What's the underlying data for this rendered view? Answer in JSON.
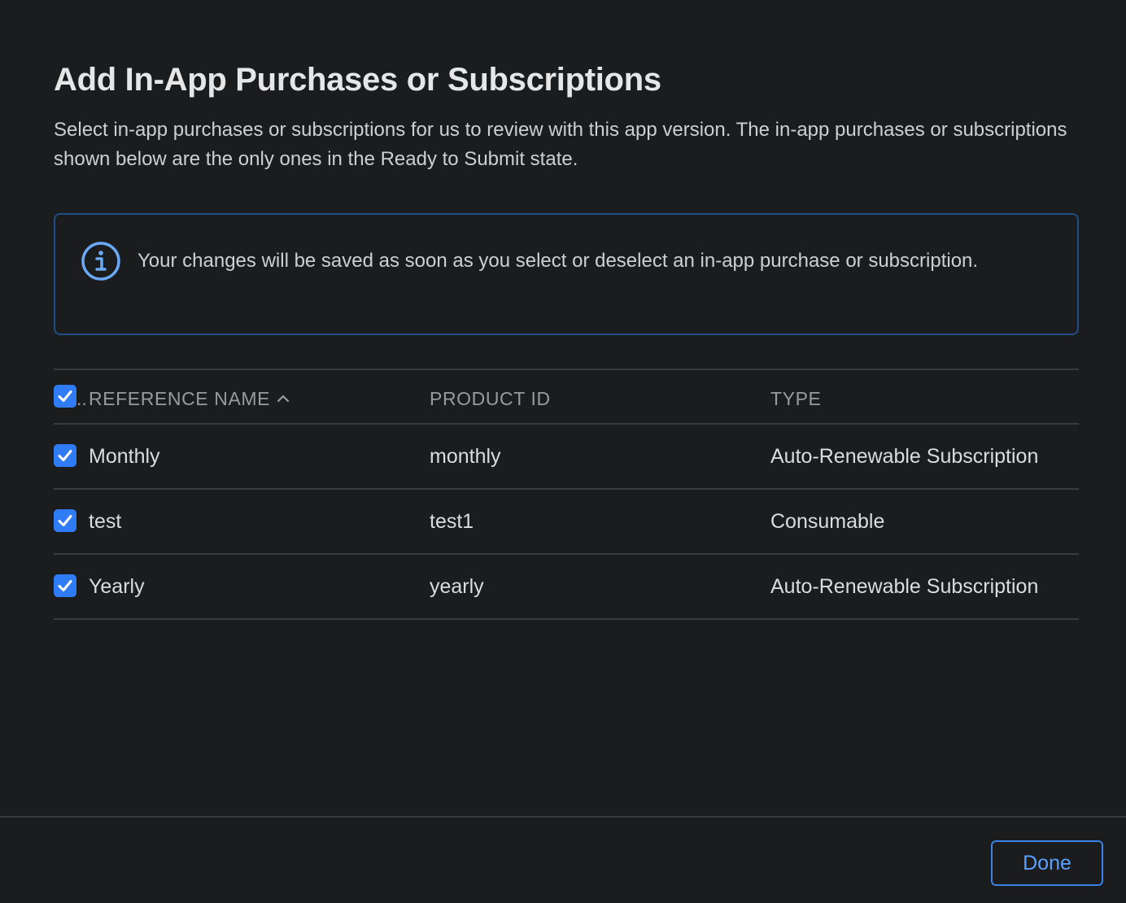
{
  "dialog": {
    "title": "Add In-App Purchases or Subscriptions",
    "description": "Select in-app purchases or subscriptions for us to review with this app version. The in-app purchases or subscriptions shown below are the only ones in the Ready to Submit state."
  },
  "info": {
    "icon": "info-circle-icon",
    "text": "Your changes will be saved as soon as you select or deselect an in-app purchase or subscription."
  },
  "table": {
    "header": {
      "ellipsis": "..",
      "reference_name": "REFERENCE NAME",
      "product_id": "PRODUCT ID",
      "type": "TYPE",
      "sort_icon": "chevron-up-icon",
      "select_all_checked": true
    },
    "rows": [
      {
        "name": "Monthly",
        "product_id": "monthly",
        "type": "Auto-Renewable Subscription",
        "checked": true
      },
      {
        "name": "test",
        "product_id": "test1",
        "type": "Consumable",
        "checked": true
      },
      {
        "name": "Yearly",
        "product_id": "yearly",
        "type": "Auto-Renewable Subscription",
        "checked": true
      }
    ]
  },
  "footer": {
    "done_label": "Done"
  },
  "colors": {
    "background": "#1b1c1e",
    "accent": "#2f7cf6",
    "info_border": "#1f4d85",
    "button_text": "#5aa0ff"
  }
}
